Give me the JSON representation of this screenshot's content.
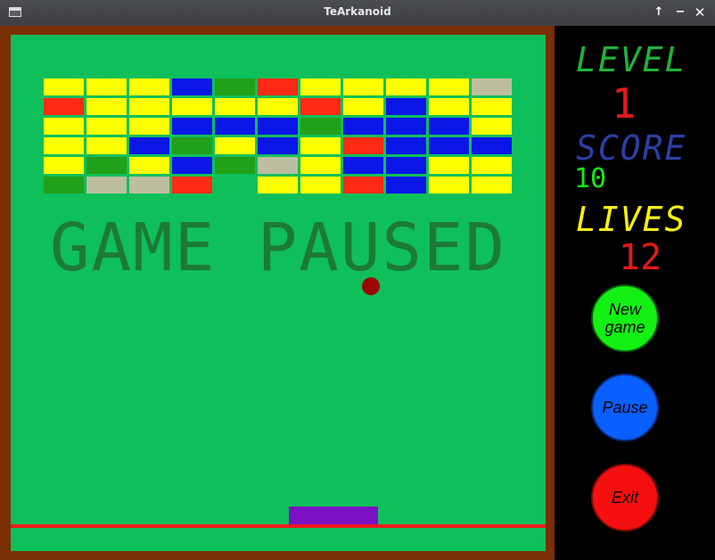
{
  "window": {
    "title": "TeArkanoid",
    "controls": [
      "↑",
      "−",
      "✕"
    ]
  },
  "colors": {
    "yellow": "#ffff00",
    "red": "#ff2a14",
    "blue": "#0a16e6",
    "darkgreen": "#21a019",
    "gray": "#bdbda0",
    "board": "#0fbf5a",
    "frame": "#7a2f04"
  },
  "bricks": {
    "rows": [
      [
        "yellow",
        "yellow",
        "yellow",
        "blue",
        "darkgreen",
        "red",
        "yellow",
        "yellow",
        "yellow",
        "yellow",
        "gray"
      ],
      [
        "red",
        "yellow",
        "yellow",
        "yellow",
        "yellow",
        "yellow",
        "red",
        "yellow",
        "blue",
        "yellow",
        "yellow"
      ],
      [
        "yellow",
        "yellow",
        "yellow",
        "blue",
        "blue",
        "blue",
        "darkgreen",
        "blue",
        "blue",
        "blue",
        "yellow"
      ],
      [
        "yellow",
        "yellow",
        "blue",
        "darkgreen",
        "yellow",
        "blue",
        "yellow",
        "red",
        "blue",
        "blue",
        "blue"
      ],
      [
        "yellow",
        "darkgreen",
        "yellow",
        "blue",
        "darkgreen",
        "gray",
        "yellow",
        "blue",
        "blue",
        "yellow",
        "yellow"
      ],
      [
        "darkgreen",
        "gray",
        "gray",
        "red",
        null,
        "yellow",
        "yellow",
        "red",
        "blue",
        "yellow",
        "yellow"
      ]
    ]
  },
  "game": {
    "status_text": "GAME PAUSED"
  },
  "panel": {
    "level_label": "LEVEL",
    "level_value": "1",
    "score_label": "SCORE",
    "score_value": "10",
    "lives_label": "LIVES",
    "lives_value": "12",
    "new_game_label_line1": "New",
    "new_game_label_line2": "game",
    "pause_label": "Pause",
    "exit_label": "Exit"
  }
}
